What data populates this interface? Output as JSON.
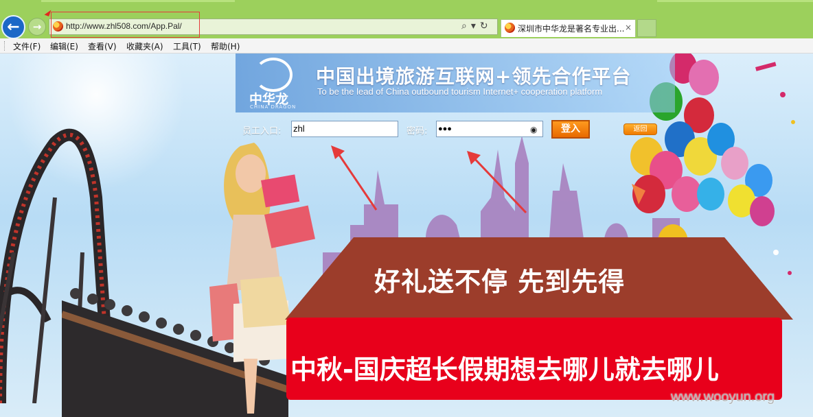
{
  "browser": {
    "url": "http://www.zhl508.com/App.Pal/",
    "tab_title": "深圳市中华龙是著名专业出...",
    "tab_close": "×",
    "menu": [
      "文件(F)",
      "编辑(E)",
      "查看(V)",
      "收藏夹(A)",
      "工具(T)",
      "帮助(H)"
    ]
  },
  "page": {
    "logo_cn": "中华龙",
    "logo_en": "CHINA DRAGON",
    "slogan_cn": "中国出境旅游互联网+领先合作平台",
    "slogan_en": "To be the lead of China outbound tourism Internet+ cooperation platform",
    "login": {
      "employee_label": "员工入口:",
      "employee_value": "zhl",
      "password_label": "密码:",
      "password_value": "●●●",
      "login_button": "登入",
      "back_button": "返回"
    },
    "banner_top": "好礼送不停 先到先得",
    "banner_bottom": "中秋-国庆超长假期想去哪儿就去哪儿",
    "watermark": "www.wooyun.org"
  },
  "colors": {
    "titlebar": "#9cd05c",
    "red_banner": "#e8001b",
    "brown_banner": "#9c3d2b",
    "login_button": "#f07a00"
  }
}
